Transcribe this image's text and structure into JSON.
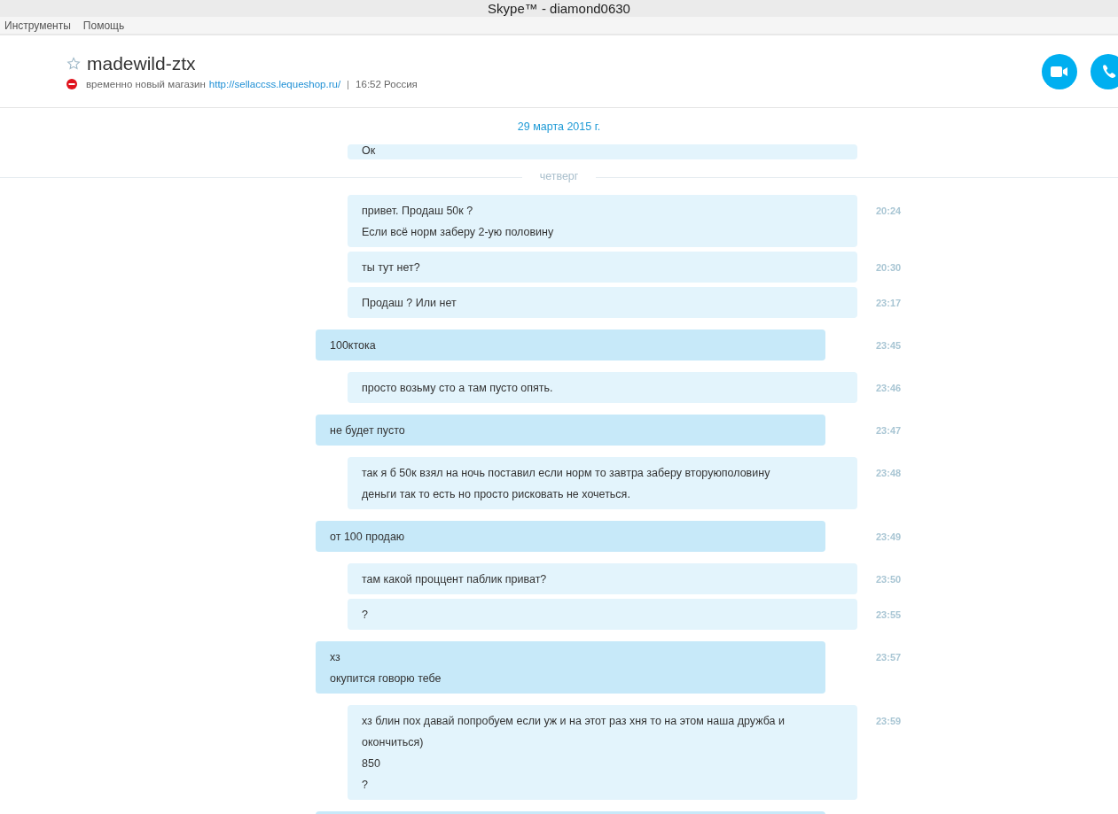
{
  "window": {
    "title": "Skype™ - diamond0630"
  },
  "menu": [
    "Инструменты",
    "Помощь"
  ],
  "contact": {
    "name": "madewild-ztx",
    "favorite": false,
    "mood": "временно новый магазин",
    "link": "http://sellaccss.lequeshop.ru/",
    "separator": "|",
    "local_time": "16:52 Россия"
  },
  "date_header": "29 марта 2015 г.",
  "messages": [
    {
      "kind": "other",
      "lines": [
        "Ок"
      ],
      "partial": true
    },
    {
      "kind": "day",
      "label": "четверг"
    },
    {
      "kind": "other",
      "time": "20:24",
      "lines": [
        "привет. Продаш 50к ?",
        "Если всё норм заберу 2-ую половину"
      ]
    },
    {
      "kind": "other",
      "time": "20:30",
      "lines": [
        "ты тут нет?"
      ]
    },
    {
      "kind": "other",
      "time": "23:17",
      "lines": [
        "Продаш ? Или нет"
      ]
    },
    {
      "kind": "own",
      "time": "23:45",
      "lines": [
        "100ктока"
      ]
    },
    {
      "kind": "other",
      "time": "23:46",
      "lines": [
        "просто возьму сто а там пусто опять."
      ]
    },
    {
      "kind": "own",
      "time": "23:47",
      "lines": [
        "не будет пусто"
      ]
    },
    {
      "kind": "other",
      "time": "23:48",
      "lines": [
        "так я б 50к взял на ночь поставил если норм то завтра заберу вторуюполовину",
        "деньги так то есть но просто рисковать не хочеться."
      ]
    },
    {
      "kind": "own",
      "time": "23:49",
      "lines": [
        "от 100 продаю"
      ]
    },
    {
      "kind": "other",
      "time": "23:50",
      "lines": [
        "там какой проццент паблик приват?"
      ]
    },
    {
      "kind": "other",
      "time": "23:55",
      "lines": [
        "?"
      ]
    },
    {
      "kind": "own",
      "time": "23:57",
      "lines": [
        "хз",
        "окупится говорю тебе"
      ]
    },
    {
      "kind": "other",
      "time": "23:59",
      "lines": [
        "хз блин пох давай попробуем если уж и на этот раз хня то на этом наша дружба и окончиться)",
        "850",
        "?"
      ]
    },
    {
      "kind": "own",
      "partial": true
    }
  ]
}
